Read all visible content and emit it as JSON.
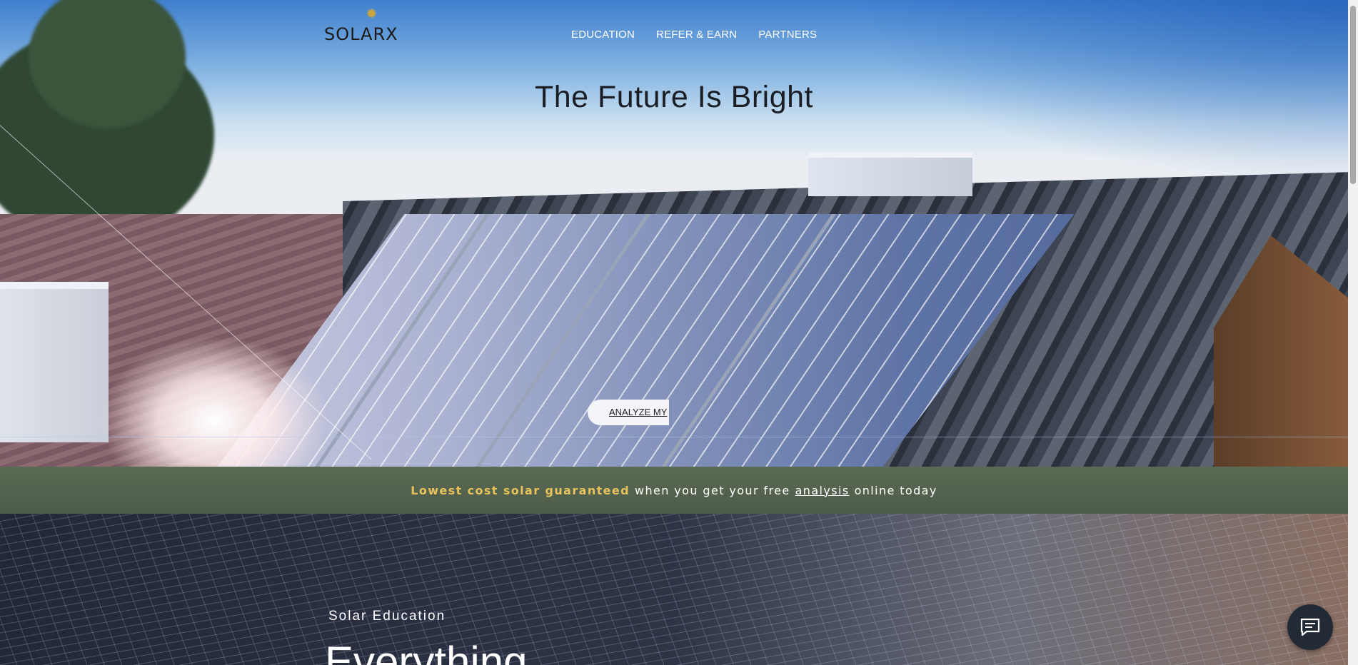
{
  "brand": {
    "logo_text": "SOLARX"
  },
  "nav": {
    "items": [
      "EDUCATION",
      "REFER & EARN",
      "PARTNERS"
    ]
  },
  "hero": {
    "title": "The Future Is Bright",
    "cta_label": "ANALYZE MY"
  },
  "banner": {
    "highlight": "Lowest cost solar guaranteed",
    "middle": "when you get your free",
    "link": "analysis",
    "end": "online today"
  },
  "education": {
    "subtitle": "Solar Education",
    "title": "Everything"
  },
  "colors": {
    "accent_gold": "#e8c25a",
    "banner_green": "#56654f",
    "nav_text": "#ffffff"
  },
  "icons": {
    "chat": "chat-bubble-icon",
    "logo_sun": "sun-icon"
  }
}
